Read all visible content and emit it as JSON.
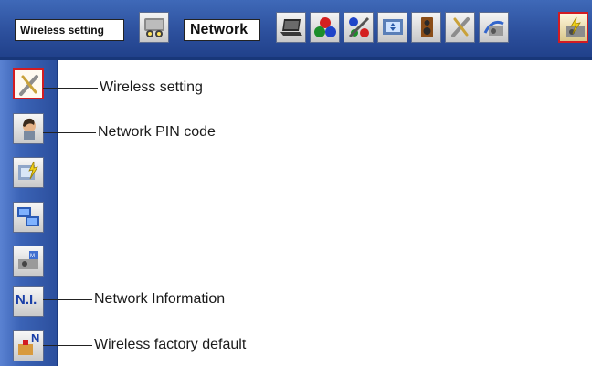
{
  "topbar": {
    "wireless_label": "Wireless setting",
    "network_label": "Network",
    "icons": [
      "projector-menu-icon",
      "laptop-icon",
      "color-balls-icon",
      "color-adjust-icon",
      "screen-icon",
      "speaker-icon",
      "setting-tool-icon",
      "projector-options-icon",
      "network-menu-icon"
    ]
  },
  "sidebar": {
    "items": [
      {
        "icon": "wireless-setting-icon",
        "label": "Wireless setting"
      },
      {
        "icon": "network-pin-icon",
        "label": "Network PIN code"
      },
      {
        "icon": "network-setting-icon",
        "label": ""
      },
      {
        "icon": "network-display-icon",
        "label": ""
      },
      {
        "icon": "projector-status-icon",
        "label": ""
      },
      {
        "icon": "network-information-icon",
        "label": "Network Information",
        "glyph": "N.I."
      },
      {
        "icon": "wireless-factory-default-icon",
        "label": "Wireless factory default",
        "glyph": "N"
      }
    ]
  },
  "colors": {
    "menu_blue": "#2c4f9c",
    "active_border": "#d21c22"
  }
}
